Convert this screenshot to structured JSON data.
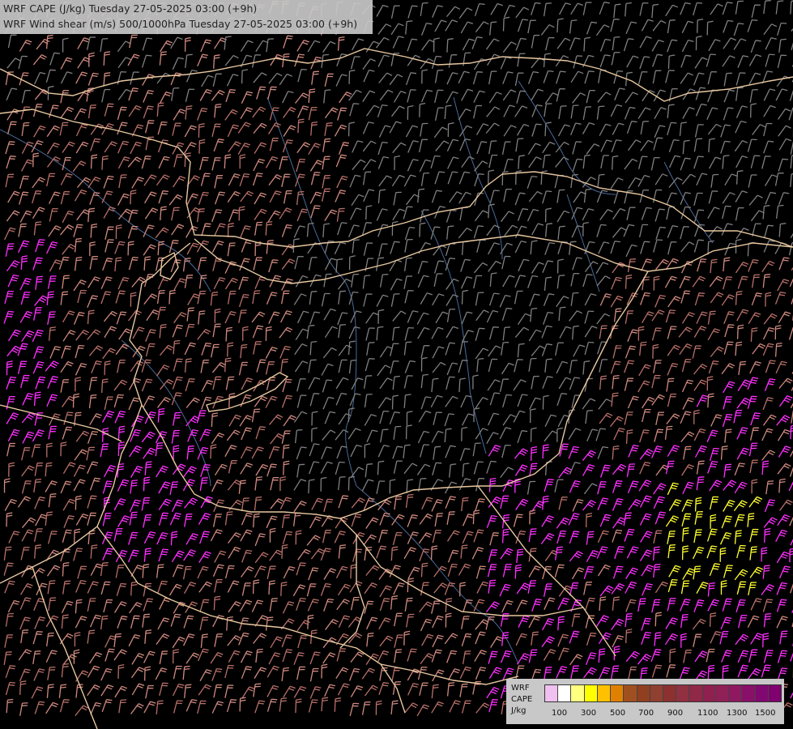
{
  "header": {
    "line1": "WRF CAPE (J/kg) Tuesday 27-05-2025 03:00 (+9h)",
    "line2": "WRF Wind shear (m/s) 500/1000hPa Tuesday 27-05-2025 03:00 (+9h)"
  },
  "legend": {
    "label_line1": "WRF",
    "label_line2": "CAPE",
    "label_line3": "J/kg",
    "colors": [
      "#f0c0f0",
      "#ffffff",
      "#ffff80",
      "#ffff00",
      "#ffc000",
      "#e08000",
      "#a05020",
      "#904020",
      "#904030",
      "#8c3030",
      "#903040",
      "#902848",
      "#902050",
      "#902058",
      "#901860",
      "#881068",
      "#800870",
      "#800070"
    ],
    "ticks": [
      "100",
      "300",
      "500",
      "700",
      "900",
      "1100",
      "1300",
      "1500"
    ]
  },
  "map": {
    "barb_colors": {
      "low": "#808080",
      "mid": "#d08a80",
      "high": "#b8706a",
      "strong": "#ff30ff",
      "extreme": "#ffff30"
    },
    "border_color": "#e8c8a0",
    "river_color": "#4a6a9a"
  }
}
